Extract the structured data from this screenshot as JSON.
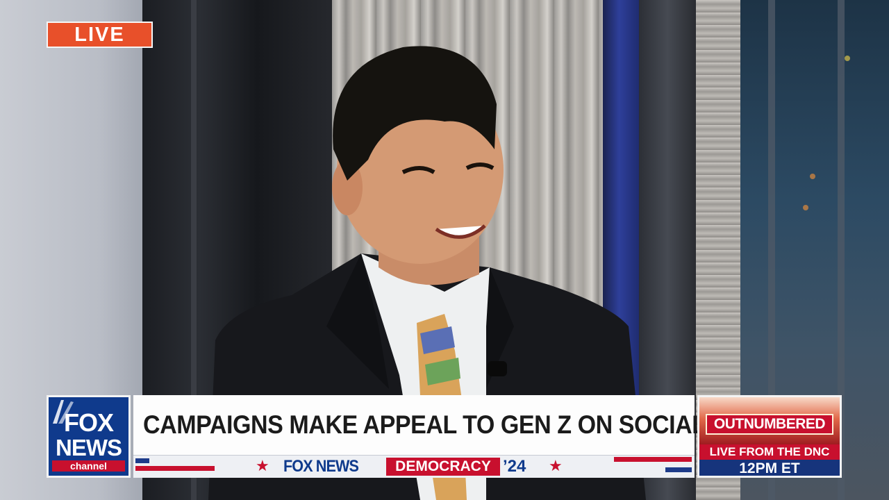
{
  "live_badge": {
    "label": "LIVE",
    "color": "#e8502a"
  },
  "network_logo": {
    "line1": "FOX",
    "line2": "NEWS",
    "line3": "channel",
    "color": "#0f3a8c"
  },
  "headline": {
    "text": "CAMPAIGNS MAKE APPEAL TO GEN Z ON SOCIAL MEDIA"
  },
  "sub_banner": {
    "brand": "FOX NEWS",
    "segment": "DEMOCRACY",
    "year_mark": "’24",
    "accent_red": "#c8102e",
    "accent_blue": "#0f3a8c"
  },
  "show_bug": {
    "show_name": "OUTNUMBERED",
    "line1": "LIVE FROM THE DNC",
    "line2": "12PM ET"
  }
}
